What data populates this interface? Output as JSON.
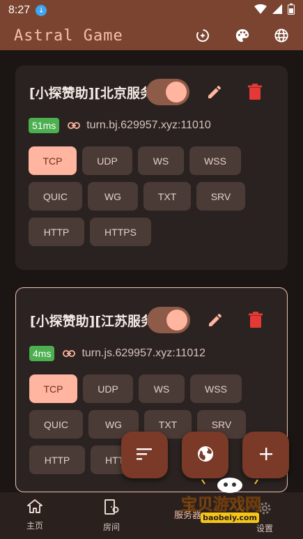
{
  "status": {
    "time": "8:27"
  },
  "app": {
    "title": "Astral Game"
  },
  "icons": {
    "theme": "auto-mode-icon",
    "palette": "palette-icon",
    "language": "globe-icon"
  },
  "servers": [
    {
      "name": "[小探赞助][北京服务器]",
      "latency": "51ms",
      "address": "turn.bj.629957.xyz:11010",
      "enabled": true,
      "protocols": [
        {
          "label": "TCP",
          "selected": true
        },
        {
          "label": "UDP",
          "selected": false
        },
        {
          "label": "WS",
          "selected": false
        },
        {
          "label": "WSS",
          "selected": false
        },
        {
          "label": "QUIC",
          "selected": false
        },
        {
          "label": "WG",
          "selected": false
        },
        {
          "label": "TXT",
          "selected": false
        },
        {
          "label": "SRV",
          "selected": false
        },
        {
          "label": "HTTP",
          "selected": false
        },
        {
          "label": "HTTPS",
          "selected": false
        }
      ]
    },
    {
      "name": "[小探赞助][江苏服务器]",
      "latency": "4ms",
      "address": "turn.js.629957.xyz:11012",
      "enabled": true,
      "protocols": [
        {
          "label": "TCP",
          "selected": true
        },
        {
          "label": "UDP",
          "selected": false
        },
        {
          "label": "WS",
          "selected": false
        },
        {
          "label": "WSS",
          "selected": false
        },
        {
          "label": "QUIC",
          "selected": false
        },
        {
          "label": "WG",
          "selected": false
        },
        {
          "label": "TXT",
          "selected": false
        },
        {
          "label": "SRV",
          "selected": false
        },
        {
          "label": "HTTP",
          "selected": false
        },
        {
          "label": "HTTPS",
          "selected": false
        }
      ]
    }
  ],
  "nav": {
    "home": "主页",
    "rooms": "房间",
    "servers": "服务器",
    "settings": "设置"
  },
  "watermark": {
    "text": "宝贝游戏网",
    "url": "baobeiy.com"
  },
  "colors": {
    "accent": "#ffb59f",
    "appbar": "#7a4430",
    "latency_ok": "#4caf50",
    "delete": "#e53935"
  }
}
